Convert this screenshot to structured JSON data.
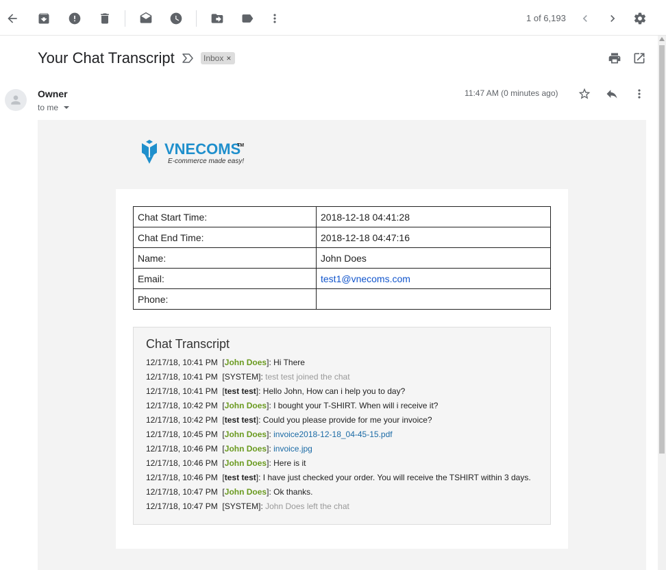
{
  "toolbar": {
    "pager_text": "1 of 6,193"
  },
  "email": {
    "subject": "Your Chat Transcript",
    "label": "Inbox",
    "label_remove": "×",
    "sender": "Owner",
    "recipient": "to me",
    "time": "11:47 AM (0 minutes ago)"
  },
  "logo": {
    "name": "VNECOMS",
    "tm": "TM",
    "tagline": "E-commerce made easy!",
    "color": "#1f8fcc"
  },
  "info": {
    "rows": [
      {
        "key": "Chat Start Time:",
        "value": "2018-12-18 04:41:28"
      },
      {
        "key": "Chat End Time:",
        "value": "2018-12-18 04:47:16"
      },
      {
        "key": "Name:",
        "value": "John Does"
      },
      {
        "key": "Email:",
        "value": "test1@vnecoms.com"
      },
      {
        "key": "Phone:",
        "value": ""
      }
    ]
  },
  "transcript": {
    "title": "Chat Transcript",
    "lines": [
      {
        "ts": "12/17/18, 10:41 PM",
        "who": "John Does",
        "msg": "Hi There"
      },
      {
        "ts": "12/17/18, 10:41 PM",
        "who": "SYSTEM",
        "msg": "test test joined the chat"
      },
      {
        "ts": "12/17/18, 10:41 PM",
        "who": "test test",
        "msg": "Hello John, How can i help you to day?"
      },
      {
        "ts": "12/17/18, 10:42 PM",
        "who": "John Does",
        "msg": "I bought your T-SHIRT. When will i receive it?"
      },
      {
        "ts": "12/17/18, 10:42 PM",
        "who": "test test",
        "msg": "Could you please provide for me your invoice?"
      },
      {
        "ts": "12/17/18, 10:45 PM",
        "who": "John Does",
        "msg": "invoice2018-12-18_04-45-15.pdf"
      },
      {
        "ts": "12/17/18, 10:46 PM",
        "who": "John Does",
        "msg": "invoice.jpg"
      },
      {
        "ts": "12/17/18, 10:46 PM",
        "who": "John Does",
        "msg": "Here is it"
      },
      {
        "ts": "12/17/18, 10:46 PM",
        "who": "test test",
        "msg": "I have just checked your order. You will receive the TSHIRT within 3 days."
      },
      {
        "ts": "12/17/18, 10:47 PM",
        "who": "John Does",
        "msg": "Ok thanks."
      },
      {
        "ts": "12/17/18, 10:47 PM",
        "who": "SYSTEM",
        "msg": "John Does left the chat"
      }
    ]
  }
}
